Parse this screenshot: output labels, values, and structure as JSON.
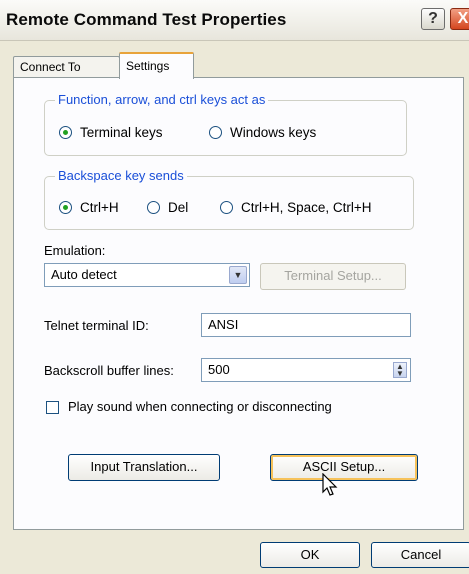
{
  "window": {
    "title": "Remote Command Test Properties"
  },
  "titlebar": {
    "help_glyph": "?",
    "close_glyph": "X"
  },
  "tabs": [
    {
      "label": "Connect To",
      "selected": false
    },
    {
      "label": "Settings",
      "selected": true
    }
  ],
  "keys_group": {
    "legend": "Function, arrow, and ctrl keys act as",
    "options": [
      {
        "label": "Terminal keys",
        "checked": true
      },
      {
        "label": "Windows keys",
        "checked": false
      }
    ]
  },
  "backspace_group": {
    "legend": "Backspace key sends",
    "options": [
      {
        "label": "Ctrl+H",
        "checked": true
      },
      {
        "label": "Del",
        "checked": false
      },
      {
        "label": "Ctrl+H, Space, Ctrl+H",
        "checked": false
      }
    ]
  },
  "emulation": {
    "label": "Emulation:",
    "value": "Auto detect",
    "terminal_setup_label": "Terminal Setup..."
  },
  "telnet": {
    "label": "Telnet terminal ID:",
    "value": "ANSI"
  },
  "backscroll": {
    "label": "Backscroll buffer lines:",
    "value": "500"
  },
  "sound": {
    "label": "Play sound when connecting or disconnecting",
    "checked": false
  },
  "buttons": {
    "input_translation": "Input Translation...",
    "ascii_setup": "ASCII Setup...",
    "ok": "OK",
    "cancel": "Cancel"
  },
  "colors": {
    "legend_text": "#1a4fd8",
    "radio_dot": "#21a121",
    "focus_ring": "#f6c25a"
  },
  "icons": {
    "dropdown": "chevron-down-icon",
    "spinner": "spinner-arrows-icon",
    "cursor": "mouse-pointer-icon"
  }
}
